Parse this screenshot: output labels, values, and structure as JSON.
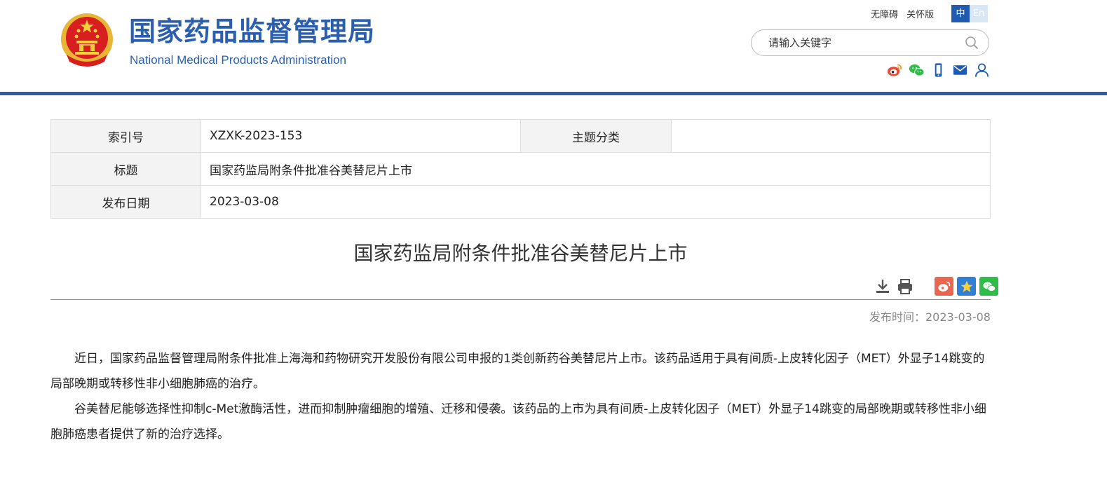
{
  "header": {
    "site_name_cn": "国家药品监督管理局",
    "site_name_en": "National Medical Products Administration",
    "accessibility": "无障碍",
    "elder_mode": "关怀版",
    "lang_zh": "中",
    "lang_en": "En",
    "search_placeholder": "请输入关键字",
    "social_icons": [
      "weibo-icon",
      "wechat-icon",
      "mobile-icon",
      "mail-icon",
      "user-icon"
    ]
  },
  "meta": {
    "index_label": "索引号",
    "index_value": "XZXK-2023-153",
    "category_label": "主题分类",
    "category_value": "",
    "title_label": "标题",
    "title_value": "国家药监局附条件批准谷美替尼片上市",
    "date_label": "发布日期",
    "date_value": "2023-03-08"
  },
  "article": {
    "title": "国家药监局附条件批准谷美替尼片上市",
    "pubtime": "发布时间：2023-03-08",
    "paragraphs": [
      "近日，国家药品监督管理局附条件批准上海海和药物研究开发股份有限公司申报的1类创新药谷美替尼片上市。该药品适用于具有间质-上皮转化因子（MET）外显子14跳变的局部晚期或转移性非小细胞肺癌的治疗。",
      "谷美替尼能够选择性抑制c-Met激酶活性，进而抑制肿瘤细胞的增殖、迁移和侵袭。该药品的上市为具有间质-上皮转化因子（MET）外显子14跳变的局部晚期或转移性非小细胞肺癌患者提供了新的治疗选择。"
    ]
  },
  "colors": {
    "brand_blue": "#2b5fae",
    "header_rule": "#2f59a6",
    "weibo_red": "#e8664f",
    "favorite_blue": "#2f7fd6",
    "wechat_green": "#2fbd4a"
  }
}
